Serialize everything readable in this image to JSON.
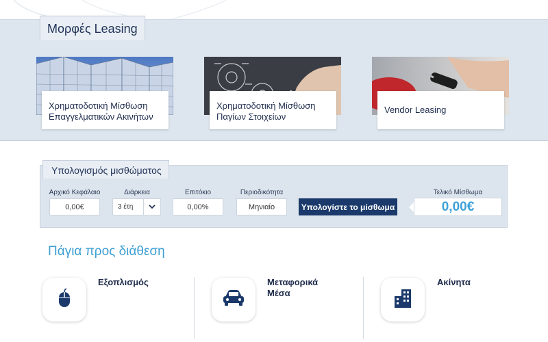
{
  "leasing_section": {
    "title": "Μορφές Leasing",
    "cards": [
      {
        "label_line1": "Χρηματοδοτική Μίσθωση",
        "label_line2": "Επαγγελματικών Ακινήτων",
        "image": "office-building-photo"
      },
      {
        "label_line1": "Χρηματοδοτική Μίσθωση",
        "label_line2": "Παγίων Στοιχείων",
        "image": "gears-hand-photo"
      },
      {
        "label_line1": "Vendor Leasing",
        "label_line2": "",
        "image": "car-key-handover-photo"
      }
    ]
  },
  "calculator": {
    "title": "Υπολογισμός μισθώματος",
    "initial_capital": {
      "label": "Αρχικό Κεφάλαιο",
      "value": "0,00€"
    },
    "duration": {
      "label": "Διάρκεια",
      "value": "3 έτη"
    },
    "interest_rate": {
      "label": "Επιτόκιο",
      "value": "0,00%"
    },
    "frequency": {
      "label": "Περιοδικότητα",
      "value": "Μηνιαίο"
    },
    "calculate_button": "Υπολογίστε το μίσθωμα",
    "final_rent": {
      "label": "Τελικό Μίσθωμα",
      "value": "0,00€"
    }
  },
  "assets": {
    "title": "Πάγια προς διάθεση",
    "items": [
      {
        "label_line1": "Εξοπλισμός",
        "label_line2": "",
        "icon": "mouse-icon"
      },
      {
        "label_line1": "Μεταφορικά",
        "label_line2": "Μέσα",
        "icon": "car-icon"
      },
      {
        "label_line1": "Ακίνητα",
        "label_line2": "",
        "icon": "building-icon"
      }
    ]
  },
  "colors": {
    "navy_button": "#1b3a6b",
    "accent_blue": "#3d9fd3",
    "section_bg": "#dde5ee"
  }
}
